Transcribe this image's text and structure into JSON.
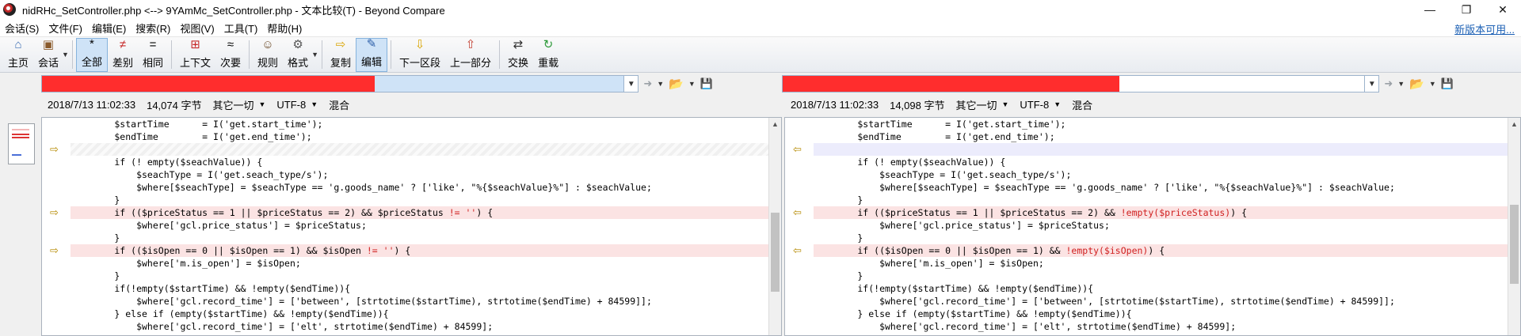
{
  "window": {
    "title": "nidRHc_SetController.php <--> 9YAmMc_SetController.php - 文本比较(T) - Beyond Compare",
    "minimize": "—",
    "restore": "❐",
    "close": "✕"
  },
  "menu": {
    "items": [
      "会话(S)",
      "文件(F)",
      "编辑(E)",
      "搜索(R)",
      "视图(V)",
      "工具(T)",
      "帮助(H)"
    ],
    "update_link": "新版本可用..."
  },
  "toolbar": {
    "buttons": [
      {
        "label": "主页",
        "icon": "home-icon",
        "glyph": "⌂",
        "color": "#3b6db3"
      },
      {
        "label": "会话",
        "icon": "session-icon",
        "glyph": "▣",
        "color": "#8a5a2b",
        "dropdown": true
      },
      {
        "label": "全部",
        "icon": "all-icon",
        "glyph": "*",
        "color": "#000",
        "active": true
      },
      {
        "label": "差别",
        "icon": "diff-icon",
        "glyph": "≠",
        "color": "#c62828"
      },
      {
        "label": "相同",
        "icon": "same-icon",
        "glyph": "=",
        "color": "#000"
      },
      {
        "label": "上下文",
        "icon": "context-icon",
        "glyph": "⊞",
        "color": "#c62828"
      },
      {
        "label": "次要",
        "icon": "minor-icon",
        "glyph": "≈",
        "color": "#000"
      },
      {
        "label": "规则",
        "icon": "rules-icon",
        "glyph": "☺",
        "color": "#6d4c2a"
      },
      {
        "label": "格式",
        "icon": "format-icon",
        "glyph": "⚙",
        "color": "#555",
        "dropdown": true
      },
      {
        "label": "复制",
        "icon": "copy-icon",
        "glyph": "⇨",
        "color": "#d9a400"
      },
      {
        "label": "编辑",
        "icon": "edit-icon",
        "glyph": "✎",
        "color": "#2b5ea8",
        "active": true
      },
      {
        "label": "下一区段",
        "icon": "next-section-icon",
        "glyph": "⇩",
        "color": "#d9a400"
      },
      {
        "label": "上一部分",
        "icon": "prev-section-icon",
        "glyph": "⇧",
        "color": "#c0392b"
      },
      {
        "label": "交换",
        "icon": "swap-icon",
        "glyph": "⇄",
        "color": "#333"
      },
      {
        "label": "重载",
        "icon": "reload-icon",
        "glyph": "↻",
        "color": "#2e9a3a"
      }
    ]
  },
  "left": {
    "date": "2018/7/13 11:02:33",
    "size": "14,074 字节",
    "other": "其它一切",
    "encoding": "UTF-8",
    "mode": "混合"
  },
  "right": {
    "date": "2018/7/13 11:02:33",
    "size": "14,098 字节",
    "other": "其它一切",
    "encoding": "UTF-8",
    "mode": "混合"
  },
  "code_left": [
    {
      "type": "same",
      "parts": [
        {
          "t": "        $startTime      = I('get.start_time');"
        }
      ]
    },
    {
      "type": "same",
      "parts": [
        {
          "t": "        $endTime        = I('get.end_time');"
        }
      ]
    },
    {
      "type": "blank",
      "arrow": true,
      "parts": [
        {
          "t": ""
        }
      ]
    },
    {
      "type": "same",
      "parts": [
        {
          "t": "        if (! empty($seachValue)) {"
        }
      ]
    },
    {
      "type": "same",
      "parts": [
        {
          "t": "            $seachType = I('get.seach_type/s');"
        }
      ]
    },
    {
      "type": "same",
      "parts": [
        {
          "t": "            $where[$seachType] = $seachType == 'g.goods_name' ? ['like', \"%{$seachValue}%\"] : $seachValue;"
        }
      ]
    },
    {
      "type": "same",
      "parts": [
        {
          "t": "        }"
        }
      ]
    },
    {
      "type": "diff",
      "arrow": true,
      "parts": [
        {
          "t": "        if (($priceStatus == 1 || $priceStatus == 2) && $priceStatus "
        },
        {
          "t": "!= ''",
          "hl": true
        },
        {
          "t": ") {"
        }
      ]
    },
    {
      "type": "same",
      "parts": [
        {
          "t": "            $where['gcl.price_status'] = $priceStatus;"
        }
      ]
    },
    {
      "type": "same",
      "parts": [
        {
          "t": "        }"
        }
      ]
    },
    {
      "type": "diff",
      "arrow": true,
      "parts": [
        {
          "t": "        if (($isOpen == 0 || $isOpen == 1) && $isOpen "
        },
        {
          "t": "!= ''",
          "hl": true
        },
        {
          "t": ") {"
        }
      ]
    },
    {
      "type": "same",
      "parts": [
        {
          "t": "            $where['m.is_open'] = $isOpen;"
        }
      ]
    },
    {
      "type": "same",
      "parts": [
        {
          "t": "        }"
        }
      ]
    },
    {
      "type": "same",
      "parts": [
        {
          "t": "        if(!empty($startTime) && !empty($endTime)){"
        }
      ]
    },
    {
      "type": "same",
      "parts": [
        {
          "t": "            $where['gcl.record_time'] = ['between', [strtotime($startTime), strtotime($endTime) + 84599]];"
        }
      ]
    },
    {
      "type": "same",
      "parts": [
        {
          "t": "        } else if (empty($startTime) && !empty($endTime)){"
        }
      ]
    },
    {
      "type": "same",
      "parts": [
        {
          "t": "            $where['gcl.record_time'] = ['elt', strtotime($endTime) + 84599];"
        }
      ]
    }
  ],
  "code_right": [
    {
      "type": "same",
      "parts": [
        {
          "t": "        $startTime      = I('get.start_time');"
        }
      ]
    },
    {
      "type": "same",
      "parts": [
        {
          "t": "        $endTime        = I('get.end_time');"
        }
      ]
    },
    {
      "type": "blank",
      "arrow": true,
      "parts": [
        {
          "t": ""
        }
      ]
    },
    {
      "type": "same",
      "parts": [
        {
          "t": "        if (! empty($seachValue)) {"
        }
      ]
    },
    {
      "type": "same",
      "parts": [
        {
          "t": "            $seachType = I('get.seach_type/s');"
        }
      ]
    },
    {
      "type": "same",
      "parts": [
        {
          "t": "            $where[$seachType] = $seachType == 'g.goods_name' ? ['like', \"%{$seachValue}%\"] : $seachValue;"
        }
      ]
    },
    {
      "type": "same",
      "parts": [
        {
          "t": "        }"
        }
      ]
    },
    {
      "type": "diff",
      "arrow": true,
      "parts": [
        {
          "t": "        if (($priceStatus == 1 || $priceStatus == 2) && "
        },
        {
          "t": "!empty($priceStatus)",
          "hl": true
        },
        {
          "t": ") {"
        }
      ]
    },
    {
      "type": "same",
      "parts": [
        {
          "t": "            $where['gcl.price_status'] = $priceStatus;"
        }
      ]
    },
    {
      "type": "same",
      "parts": [
        {
          "t": "        }"
        }
      ]
    },
    {
      "type": "diff",
      "arrow": true,
      "parts": [
        {
          "t": "        if (($isOpen == 0 || $isOpen == 1) && "
        },
        {
          "t": "!empty($isOpen)",
          "hl": true
        },
        {
          "t": ") {"
        }
      ]
    },
    {
      "type": "same",
      "parts": [
        {
          "t": "            $where['m.is_open'] = $isOpen;"
        }
      ]
    },
    {
      "type": "same",
      "parts": [
        {
          "t": "        }"
        }
      ]
    },
    {
      "type": "same",
      "parts": [
        {
          "t": "        if(!empty($startTime) && !empty($endTime)){"
        }
      ]
    },
    {
      "type": "same",
      "parts": [
        {
          "t": "            $where['gcl.record_time'] = ['between', [strtotime($startTime), strtotime($endTime) + 84599]];"
        }
      ]
    },
    {
      "type": "same",
      "parts": [
        {
          "t": "        } else if (empty($startTime) && !empty($endTime)){"
        }
      ]
    },
    {
      "type": "same",
      "parts": [
        {
          "t": "            $where['gcl.record_time'] = ['elt', strtotime($endTime) + 84599];"
        }
      ]
    }
  ],
  "colors": {
    "diff_bg": "#fbe3e3",
    "highlight_text": "#d01f1f",
    "redaction": "#ff2d2d"
  }
}
